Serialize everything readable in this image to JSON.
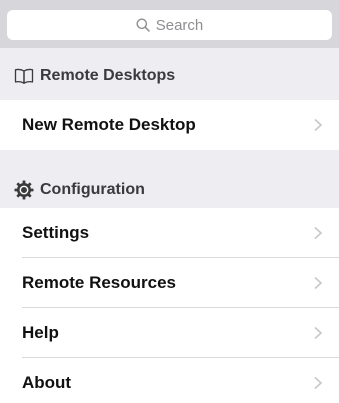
{
  "search": {
    "placeholder": "Search",
    "icon": "search-icon"
  },
  "sections": {
    "remote_desktops": {
      "title": "Remote Desktops",
      "icon": "book-icon",
      "items": [
        {
          "label": "New Remote Desktop"
        }
      ]
    },
    "configuration": {
      "title": "Configuration",
      "icon": "gear-icon",
      "items": [
        {
          "label": "Settings"
        },
        {
          "label": "Remote Resources"
        },
        {
          "label": "Help"
        },
        {
          "label": "About"
        }
      ]
    }
  },
  "colors": {
    "search_bg": "#d6d6db",
    "section_bg": "#eeeef2",
    "chevron": "#c7c7cc"
  }
}
